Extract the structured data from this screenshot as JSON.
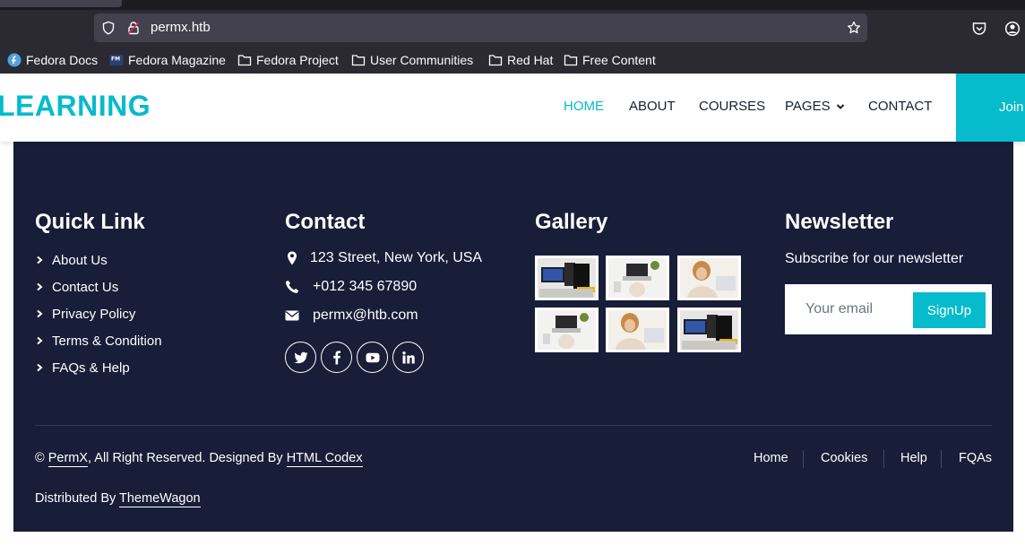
{
  "browser": {
    "url": "permx.htb",
    "bookmarks": [
      "Fedora Docs",
      "Fedora Magazine",
      "Fedora Project",
      "User Communities",
      "Red Hat",
      "Free Content"
    ]
  },
  "navbar": {
    "brand": "LEARNING",
    "links": [
      "HOME",
      "ABOUT",
      "COURSES",
      "PAGES",
      "CONTACT"
    ],
    "active": "HOME",
    "join_label": "Join"
  },
  "footer": {
    "quick_link": {
      "title": "Quick Link",
      "items": [
        "About Us",
        "Contact Us",
        "Privacy Policy",
        "Terms & Condition",
        "FAQs & Help"
      ]
    },
    "contact": {
      "title": "Contact",
      "address": "123 Street, New York, USA",
      "phone": "+012 345 67890",
      "email": "permx@htb.com",
      "social": [
        "twitter-icon",
        "facebook-icon",
        "youtube-icon",
        "linkedin-icon"
      ]
    },
    "gallery": {
      "title": "Gallery",
      "images": [
        "course-1",
        "course-2",
        "course-3",
        "course-2",
        "course-3",
        "course-1"
      ]
    },
    "newsletter": {
      "title": "Newsletter",
      "subtitle": "Subscribe for our newsletter",
      "placeholder": "Your email",
      "button": "SignUp"
    },
    "copyright": {
      "prefix": "©",
      "site": "PermX",
      "middle": ", All Right Reserved. Designed By",
      "designer": "HTML Codex"
    },
    "distributed": {
      "prefix": "Distributed By",
      "by": "ThemeWagon"
    },
    "menu": [
      "Home",
      "Cookies",
      "Help",
      "FQAs"
    ]
  },
  "colors": {
    "accent": "#06bbcc",
    "footer_bg": "#181d38",
    "chrome_bg": "#2b2a33"
  }
}
